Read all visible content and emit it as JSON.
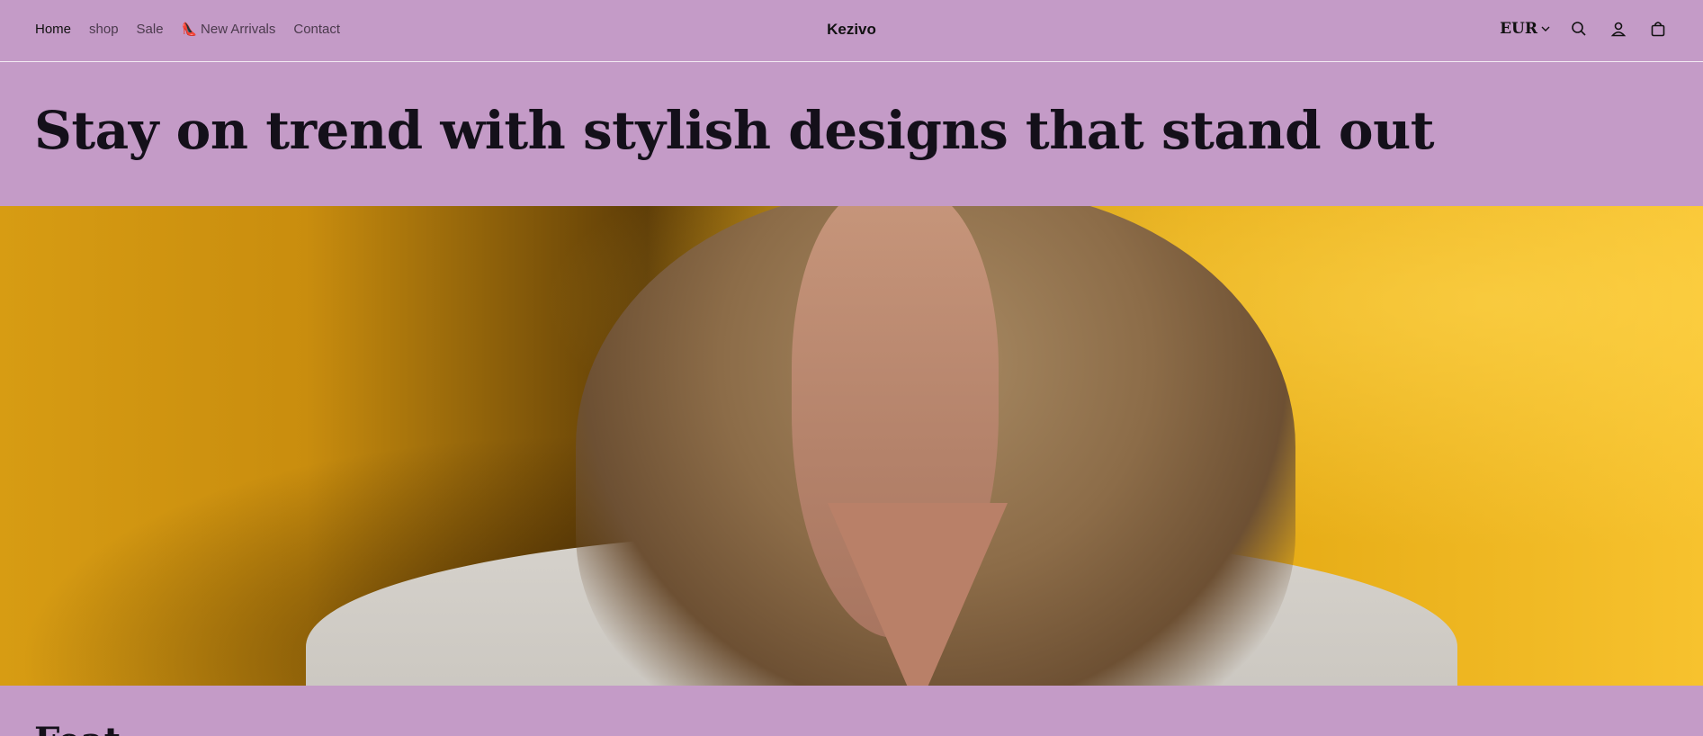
{
  "header": {
    "brand": "Kezivo",
    "nav": [
      {
        "label": "Home",
        "active": true
      },
      {
        "label": "shop",
        "active": false
      },
      {
        "label": "Sale",
        "active": false
      },
      {
        "label": "New Arrivals",
        "emoji": "👠",
        "active": false
      },
      {
        "label": "Contact",
        "active": false
      }
    ],
    "currency": "EUR",
    "icons": [
      "search-icon",
      "account-icon",
      "cart-icon"
    ]
  },
  "hero": {
    "headline": "Stay on trend with stylish designs that stand out"
  },
  "next_section": {
    "partial_heading": "Feat"
  },
  "colors": {
    "background": "#c49bc7",
    "text": "#14101a",
    "hero_yellow": "#e3a812"
  }
}
